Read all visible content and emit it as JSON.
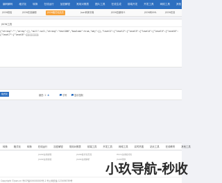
{
  "topnav": {
    "items": [
      "编码解码",
      "格式化",
      "转换",
      "在线运行",
      "加密解密",
      "常用对照表",
      "图片工具",
      "在线生成",
      "前端开发",
      "开发工具",
      "网络工具",
      "其他"
    ]
  },
  "tabs": {
    "items": [
      "JSON校验",
      "JSON在线编辑",
      "JSON格式化高亮",
      "Json转换字典",
      "JSON压缩转义",
      "JSON转XML",
      "JSON在线"
    ],
    "active_index": 2
  },
  "panel": {
    "title": "JSON工具",
    "json_lines": [
      "{\"string\":\"\",\"array\":[],\"null\":null,\"string\":\"test100\",\"boolean\":true,\"obj\":{},\"level1\":{\"level2\":{\"level3\":{\"level4\":{\"level5\":{\"level6\":",
      "{\"level7\":{\"level8\":{}}}}}}}}}"
    ]
  },
  "toolbar": {
    "run_label": "格式化",
    "indent_label": "缩进:",
    "indent_value": "2",
    "indent_alt": "4",
    "checkboxes": [
      {
        "label": "引号",
        "checked": true
      },
      {
        "label": "显示控制",
        "checked": true
      }
    ]
  },
  "footnav": {
    "items": [
      "转换",
      "格式化",
      "转换",
      "在线运行",
      "加密解密",
      "常用对照表",
      "前端工具",
      "开发工具",
      "网络工具",
      "实时热搜",
      "站长工具",
      "在线教育",
      "其他工具"
    ]
  },
  "friend_links": [
    "JSON在线编辑",
    "JSON格式化高亮",
    "Html在线格式化",
    "JSON在线校验",
    "JSON在线解析",
    "JSON转换"
  ],
  "bottom": {
    "icp": "Copyright ©json.cn 粤ICP备XXXXXXXX号-2 粤公网安备 123456789号"
  },
  "watermark": "小玖导航-秒收",
  "colors": {
    "nav_blue": "#2d6fc0",
    "active_tab": "#f7a23a"
  }
}
